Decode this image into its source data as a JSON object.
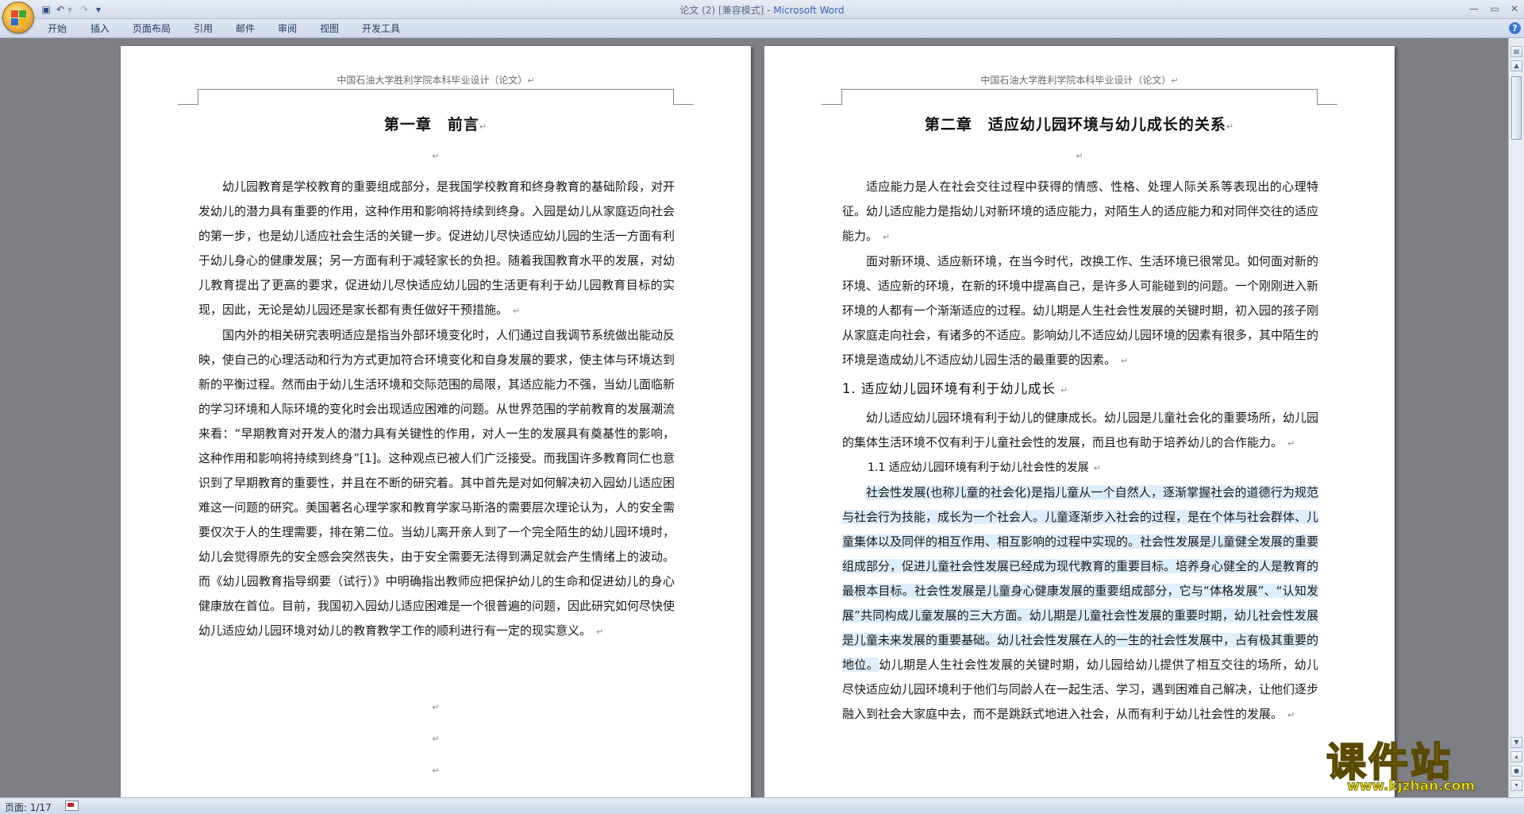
{
  "window": {
    "title_doc": "论文 (2) [兼容模式]",
    "title_sep": " - ",
    "title_app": "Microsoft Word"
  },
  "ribbon_tabs": [
    "开始",
    "插入",
    "页面布局",
    "引用",
    "邮件",
    "审阅",
    "视图",
    "开发工具"
  ],
  "left_page": {
    "header": "中国石油大学胜利学院本科毕业设计（论文）",
    "title": "第一章　前言",
    "paragraphs": [
      "幼儿园教育是学校教育的重要组成部分，是我国学校教育和终身教育的基础阶段，对开发幼儿的潜力具有重要的作用，这种作用和影响将持续到终身。入园是幼儿从家庭迈向社会的第一步，也是幼儿适应社会生活的关键一步。促进幼儿尽快适应幼儿园的生活一方面有利于幼儿身心的健康发展；另一方面有利于减轻家长的负担。随着我国教育水平的发展，对幼儿教育提出了更高的要求，促进幼儿尽快适应幼儿园的生活更有利于幼儿园教育目标的实现，因此，无论是幼儿园还是家长都有责任做好干预措施。",
      "国内外的相关研究表明适应是指当外部环境变化时，人们通过自我调节系统做出能动反映，使自己的心理活动和行为方式更加符合环境变化和自身发展的要求，使主体与环境达到新的平衡过程。然而由于幼儿生活环境和交际范围的局限，其适应能力不强，当幼儿面临新的学习环境和人际环境的变化时会出现适应困难的问题。从世界范围的学前教育的发展潮流来看：“早期教育对开发人的潜力具有关键性的作用，对人一生的发展具有奠基性的影响，这种作用和影响将持续到终身”[1]。这种观点已被人们广泛接受。而我国许多教育同仁也意识到了早期教育的重要性，并且在不断的研究着。其中首先是对如何解决初入园幼儿适应困难这一问题的研究。美国著名心理学家和教育学家马斯洛的需要层次理论认为，人的安全需要仅次于人的生理需要，排在第二位。当幼儿离开亲人到了一个完全陌生的幼儿园环境时，幼儿会觉得原先的安全感会突然丧失，由于安全需要无法得到满足就会产生情绪上的波动。而《幼儿园教育指导纲要（试行）》中明确指出教师应把保护幼儿的生命和促进幼儿的身心健康放在首位。目前，我国初入园幼儿适应困难是一个很普遍的问题，因此研究如何尽快使幼儿适应幼儿园环境对幼儿的教育教学工作的顺利进行有一定的现实意义。"
    ],
    "para_mark": "↵"
  },
  "right_page": {
    "header": "中国石油大学胜利学院本科毕业设计（论文）",
    "title": "第二章　适应幼儿园环境与幼儿成长的关系",
    "intro_paragraphs": [
      "适应能力是人在社会交往过程中获得的情感、性格、处理人际关系等表现出的心理特征。幼儿适应能力是指幼儿对新环境的适应能力，对陌生人的适应能力和对同伴交往的适应能力。",
      "面对新环境、适应新环境，在当今时代，改换工作、生活环境已很常见。如何面对新的环境、适应新的环境，在新的环境中提高自己，是许多人可能碰到的问题。一个刚刚进入新环境的人都有一个渐渐适应的过程。幼儿期是人生社会性发展的关键时期，初入园的孩子刚从家庭走向社会，有诸多的不适应。影响幼儿不适应幼儿园环境的因素有很多，其中陌生的环境是造成幼儿不适应幼儿园生活的最重要的因素。"
    ],
    "section1_heading": "1. 适应幼儿园环境有利于幼儿成长",
    "section1_paragraph": "幼儿适应幼儿园环境有利于幼儿的健康成长。幼儿园是儿童社会化的重要场所，幼儿园的集体生活环境不仅有利于儿童社会性的发展，而且也有助于培养幼儿的合作能力。",
    "subsection_heading": "1.1 适应幼儿园环境有利于幼儿社会性的发展",
    "highlighted_text": "社会性发展(也称儿童的社会化)是指儿童从一个自然人，逐渐掌握社会的道德行为规范与社会行为技能，成长为一个社会人。儿童逐渐步入社会的过程，是在个体与社会群体、儿童集体以及同伴的相互作用、相互影响的过程中实现的。社会性发展是儿童健全发展的重要组成部分，促进儿童社会性发展已经成为现代教育的重要目标。培养身心健全的人是教育的最根本目标。社会性发展是儿童身心健康发展的重要组成部分，它与“体格发展”、“认知发展”共同构成儿童发展的三大方面。幼儿期是儿童社会性发展的重要时期，幼儿社会性发展是儿童未来发展的重要基础。幼儿社会性发展在人的一生的社会性发展中，占有极其重要的地位。",
    "plain_text": "幼儿期是人生社会性发展的关键时期，幼儿园给幼儿提供了相互交往的场所，幼儿尽快适应幼儿园环境利于他们与同龄人在一起生活、学习，遇到困难自己解决，让他们逐步融入到社会大家庭中去，而不是跳跃式地进入社会，从而有利于幼儿社会性的发展。"
  },
  "status_bar": {
    "page_label": "页面: 1/17"
  },
  "watermark": {
    "title": "课件站",
    "url": "www.kjzhan.com"
  },
  "colors": {
    "background": "#7d7f85",
    "highlight": "#ddeefc",
    "watermark": "#f2ea12",
    "app_title": "#3a63b4"
  }
}
